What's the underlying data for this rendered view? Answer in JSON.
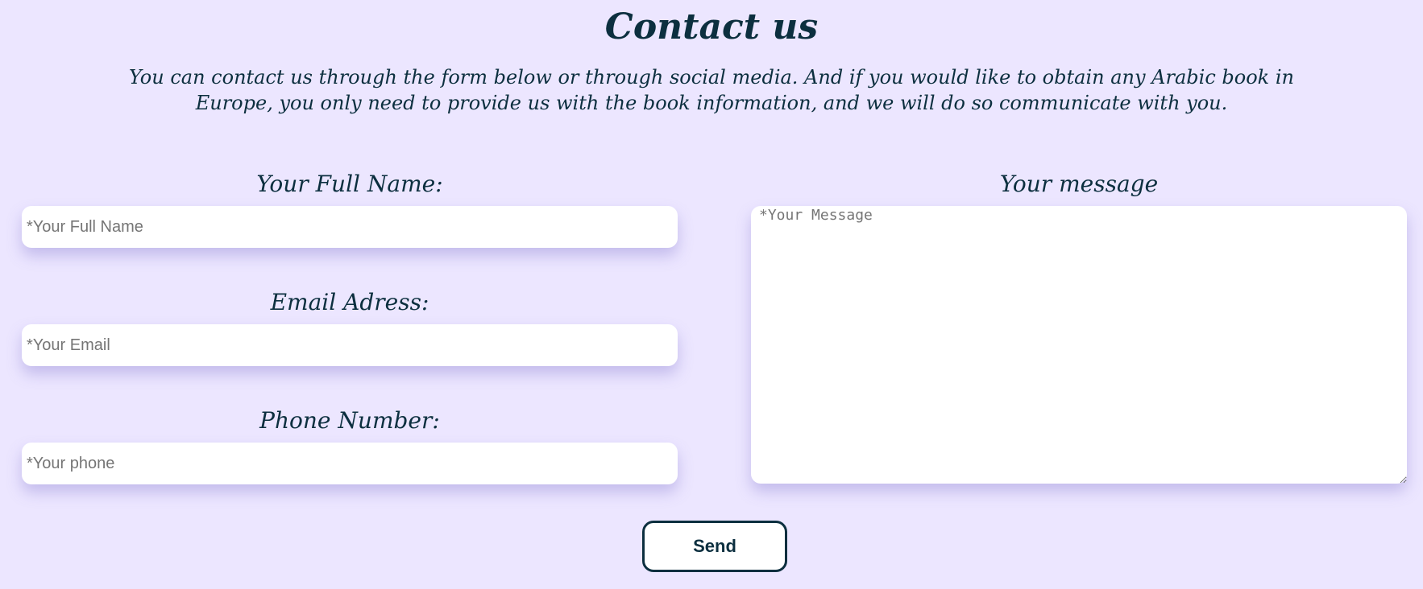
{
  "page": {
    "title": "Contact us",
    "intro": "You can contact us through the form below or through social media. And if you would like to obtain any Arabic book in Europe, you only need to provide us with the book information, and we will do so communicate with you."
  },
  "form": {
    "full_name": {
      "label": "Your Full Name:",
      "placeholder": "*Your Full Name"
    },
    "email": {
      "label": "Email Adress:",
      "placeholder": "*Your Email"
    },
    "phone": {
      "label": "Phone Number:",
      "placeholder": "*Your phone"
    },
    "message": {
      "label": "Your message",
      "placeholder": "*Your Message"
    },
    "send_label": "Send"
  },
  "colors": {
    "background": "#ece6ff",
    "text": "#0c2f3f",
    "field_background": "#ffffff",
    "placeholder": "#757575"
  }
}
